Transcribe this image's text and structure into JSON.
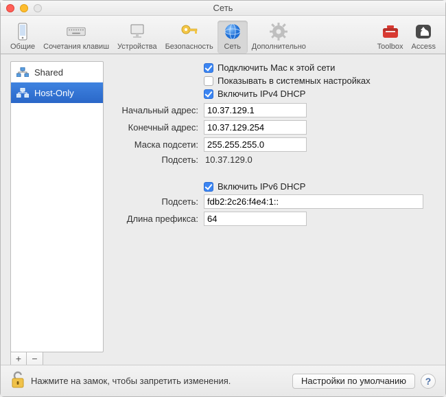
{
  "window": {
    "title": "Сеть"
  },
  "toolbar": {
    "left": [
      {
        "key": "general",
        "label": "Общие",
        "icon": "phone-icon"
      },
      {
        "key": "shortcuts",
        "label": "Сочетания клавиш",
        "icon": "keyboard-icon"
      },
      {
        "key": "devices",
        "label": "Устройства",
        "icon": "display-icon"
      },
      {
        "key": "security",
        "label": "Безопасность",
        "icon": "key-icon"
      },
      {
        "key": "network",
        "label": "Сеть",
        "icon": "globe-icon",
        "selected": true
      },
      {
        "key": "advanced",
        "label": "Дополнительно",
        "icon": "gear-icon"
      }
    ],
    "right": [
      {
        "key": "toolbox",
        "label": "Toolbox",
        "icon": "toolbox-icon"
      },
      {
        "key": "access",
        "label": "Access",
        "icon": "access-icon"
      }
    ]
  },
  "sidebar": {
    "items": [
      {
        "label": "Shared",
        "selected": false
      },
      {
        "label": "Host-Only",
        "selected": true
      }
    ],
    "add": "+",
    "remove": "−"
  },
  "form": {
    "connect_mac": {
      "label": "Подключить Mac к этой сети",
      "checked": true
    },
    "show_system": {
      "label": "Показывать в системных настройках",
      "checked": false
    },
    "ipv4_dhcp": {
      "label": "Включить IPv4 DHCP",
      "checked": true
    },
    "start_addr": {
      "label": "Начальный адрес:",
      "value": "10.37.129.1"
    },
    "end_addr": {
      "label": "Конечный адрес:",
      "value": "10.37.129.254"
    },
    "mask": {
      "label": "Маска подсети:",
      "value": "255.255.255.0"
    },
    "v4_subnet": {
      "label": "Подсеть:",
      "value": "10.37.129.0"
    },
    "ipv6_dhcp": {
      "label": "Включить IPv6 DHCP",
      "checked": true
    },
    "v6_subnet": {
      "label": "Подсеть:",
      "value": "fdb2:2c26:f4e4:1::"
    },
    "prefix_len": {
      "label": "Длина префикса:",
      "value": "64"
    }
  },
  "footer": {
    "lock_text": "Нажмите на замок, чтобы запретить изменения.",
    "defaults_btn": "Настройки по умолчанию",
    "help": "?"
  },
  "colors": {
    "accent": "#3b85f2",
    "selection": "#2a67c8"
  }
}
